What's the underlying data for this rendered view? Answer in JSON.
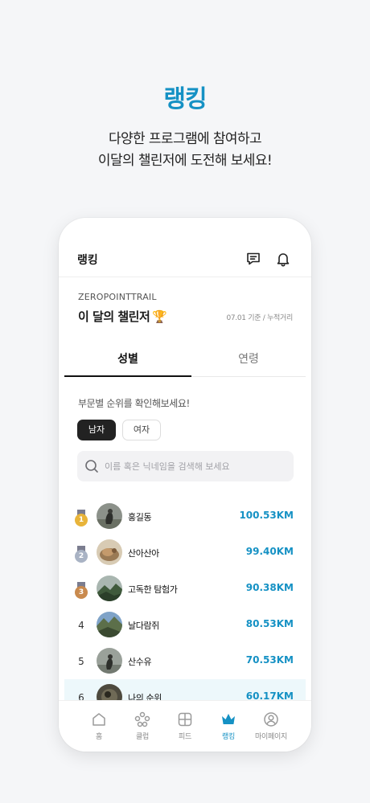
{
  "promo": {
    "title": "랭킹",
    "subtitle_line1": "다양한 프로그램에 참여하고",
    "subtitle_line2": "이달의 챌린저에 도전해 보세요!"
  },
  "header": {
    "title": "랭킹",
    "icons": [
      "chat-icon",
      "bell-icon"
    ]
  },
  "challenge": {
    "brand": "ZEROPOINTTRAIL",
    "title": "이 달의 챌린저",
    "trophy": "🏆",
    "basis": "07.01 기준 / 누적거리"
  },
  "tabs": [
    {
      "label": "성별",
      "active": true
    },
    {
      "label": "연령",
      "active": false
    }
  ],
  "filter": {
    "prompt": "부문별 순위를 확인해보세요!",
    "options": [
      {
        "label": "남자",
        "selected": true
      },
      {
        "label": "여자",
        "selected": false
      }
    ]
  },
  "search": {
    "placeholder": "이름 혹은 닉네임을 검색해 보세요",
    "value": ""
  },
  "rankings": [
    {
      "rank": "1",
      "medal": "gold",
      "name": "홍길동",
      "distance": "100.53KM"
    },
    {
      "rank": "2",
      "medal": "silver",
      "name": "산아산아",
      "distance": "99.40KM"
    },
    {
      "rank": "3",
      "medal": "bronze",
      "name": "고독한 탐험가",
      "distance": "90.38KM"
    },
    {
      "rank": "4",
      "medal": null,
      "name": "날다람쥐",
      "distance": "80.53KM"
    },
    {
      "rank": "5",
      "medal": null,
      "name": "산수유",
      "distance": "70.53KM"
    },
    {
      "rank": "6",
      "medal": null,
      "name": "나의 순위",
      "distance": "60.17KM",
      "mine": true
    }
  ],
  "nav": [
    {
      "label": "홈",
      "icon": "home-icon",
      "active": false
    },
    {
      "label": "클럽",
      "icon": "club-icon",
      "active": false
    },
    {
      "label": "피드",
      "icon": "feed-icon",
      "active": false
    },
    {
      "label": "랭킹",
      "icon": "crown-icon",
      "active": true
    },
    {
      "label": "마이페이지",
      "icon": "profile-icon",
      "active": false
    }
  ],
  "colors": {
    "accent": "#1591c4",
    "gold": "#e8b43a",
    "silver": "#a9b3c4",
    "bronze": "#c98a4e",
    "my_row_bg": "#edf8fb"
  }
}
